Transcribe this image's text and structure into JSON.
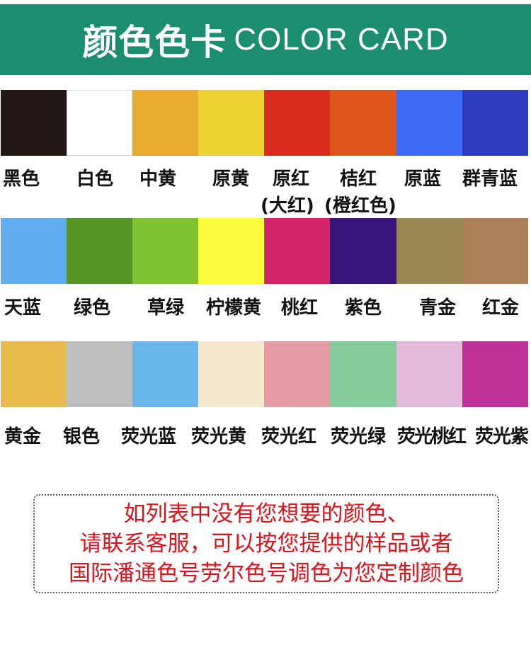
{
  "header": {
    "title_cn": "颜色色卡",
    "title_en": "COLOR CARD",
    "background": "#1b8e6f"
  },
  "rows": [
    {
      "swatches": [
        {
          "name": "黑色",
          "color": "#231815"
        },
        {
          "name": "白色",
          "color": "#ffffff"
        },
        {
          "name": "中黄",
          "color": "#e9ad2e"
        },
        {
          "name": "原黄",
          "color": "#f0d333"
        },
        {
          "name": "原红",
          "sub": "(大红)",
          "color": "#d92b20"
        },
        {
          "name": "桔红",
          "sub": "(橙红色)",
          "color": "#de561b"
        },
        {
          "name": "原蓝",
          "color": "#3f6af6"
        },
        {
          "name": "群青蓝",
          "color": "#2c3ebd"
        }
      ]
    },
    {
      "swatches": [
        {
          "name": "天蓝",
          "color": "#62acf2"
        },
        {
          "name": "绿色",
          "color": "#579527"
        },
        {
          "name": "草绿",
          "color": "#7dc331"
        },
        {
          "name": "柠檬黄",
          "color": "#fefc3e"
        },
        {
          "name": "桃红",
          "color": "#d4256b"
        },
        {
          "name": "紫色",
          "color": "#371477"
        },
        {
          "name": "青金",
          "color": "#9a8751"
        },
        {
          "name": "红金",
          "color": "#ab7f58"
        }
      ]
    },
    {
      "swatches": [
        {
          "name": "黄金",
          "color": "#e8bb4c"
        },
        {
          "name": "银色",
          "color": "#bfbfc1"
        },
        {
          "name": "荧光蓝",
          "color": "#6bb6ea"
        },
        {
          "name": "荧光黄",
          "color": "#f5e9cd"
        },
        {
          "name": "荧光红",
          "color": "#e59aa6"
        },
        {
          "name": "荧光绿",
          "color": "#84cd9a"
        },
        {
          "name": "荧光桃红",
          "color": "#e5b9da"
        },
        {
          "name": "荧光紫",
          "color": "#bd3196"
        }
      ]
    }
  ],
  "notice": {
    "lines": [
      "如列表中没有您想要的颜色、",
      "请联系客服，可以按您提供的样品或者",
      "国际潘通色号劳尔色号调色为您定制颜色"
    ],
    "color": "#d9141c"
  }
}
